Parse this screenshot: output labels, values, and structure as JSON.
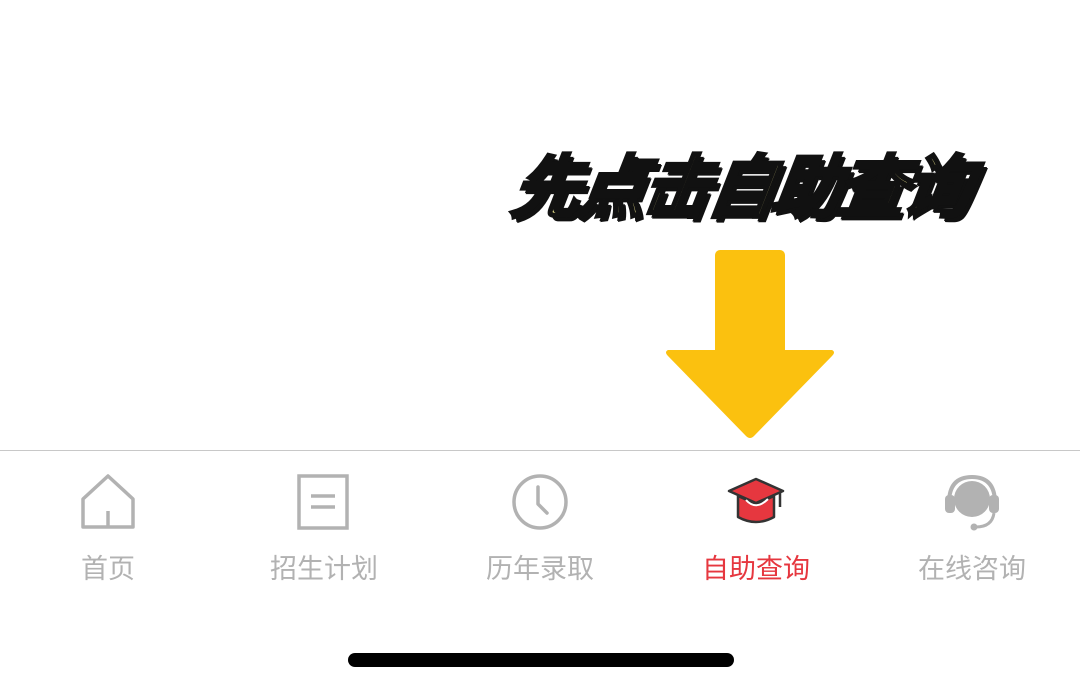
{
  "annotation": {
    "text": "先点击自助查询",
    "arrow_icon": "down-arrow-icon",
    "arrow_color": "#FBC10F",
    "text_color": "#F6EE93"
  },
  "tabbar": {
    "active_color": "#E6373F",
    "inactive_color": "#B2B2B2",
    "items": [
      {
        "label": "首页",
        "icon": "home-icon",
        "active": false
      },
      {
        "label": "招生计划",
        "icon": "document-icon",
        "active": false
      },
      {
        "label": "历年录取",
        "icon": "clock-icon",
        "active": false
      },
      {
        "label": "自助查询",
        "icon": "graduation-cap-icon",
        "active": true
      },
      {
        "label": "在线咨询",
        "icon": "headset-icon",
        "active": false
      }
    ]
  }
}
